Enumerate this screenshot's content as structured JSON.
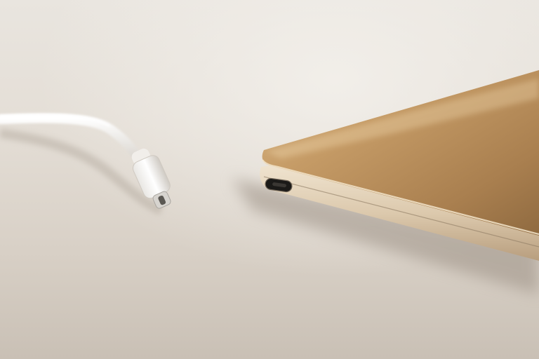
{
  "scene": {
    "subjects": [
      "usb-c-cable",
      "laptop"
    ],
    "colors": {
      "surface_light": "#eae6e0",
      "surface_mid": "#d9d2c9",
      "surface_dark": "#c4bcb1",
      "laptop_gold_light": "#d9b684",
      "laptop_gold_dark": "#9c7447",
      "laptop_edge": "#e2d3bd",
      "cable_white": "#f4f2ee",
      "port_black": "#141414"
    }
  }
}
